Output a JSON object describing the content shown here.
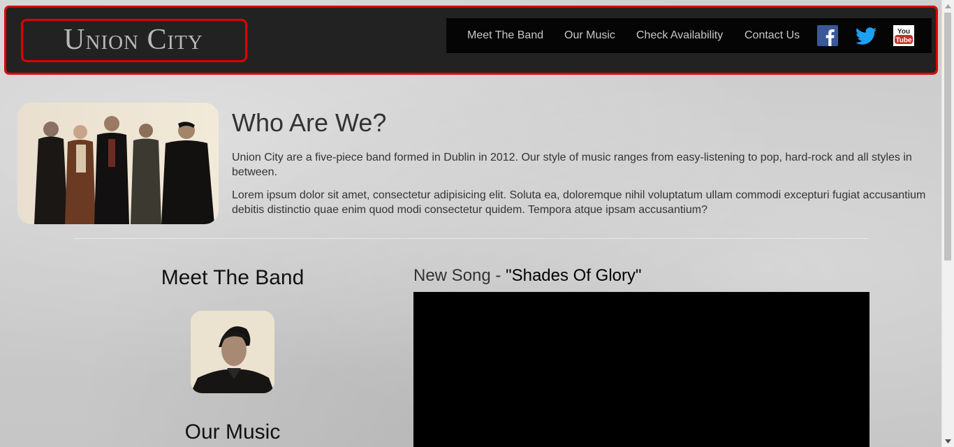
{
  "header": {
    "brand": "Union City",
    "nav": [
      {
        "label": "Meet The Band"
      },
      {
        "label": "Our Music"
      },
      {
        "label": "Check Availability"
      },
      {
        "label": "Contact Us"
      }
    ],
    "social": [
      "facebook-icon",
      "twitter-icon",
      "youtube-icon"
    ],
    "youtube_label_top": "You",
    "youtube_label_bottom": "Tube"
  },
  "about": {
    "title": "Who Are We?",
    "paragraph1": "Union City are a five-piece band formed in Dublin in 2012. Our style of music ranges from easy-listening to pop, hard-rock and all styles in between.",
    "paragraph2": "Lorem ipsum dolor sit amet, consectetur adipisicing elit. Soluta ea, doloremque nihil voluptatum ullam commodi excepturi fugiat accusantium debitis distinctio quae enim quod modi consectetur quidem. Tempora atque ipsam accusantium?"
  },
  "meet_band": {
    "title": "Meet The Band"
  },
  "our_music": {
    "title": "Our Music"
  },
  "new_song": {
    "prefix": "New Song",
    "separator": " - ",
    "name": "\"Shades Of Glory\""
  },
  "colors": {
    "navbar_bg": "#222222",
    "nav_panel_bg": "#050505",
    "highlight_outline": "#e00000",
    "facebook": "#3b5998",
    "twitter": "#1da1f2",
    "youtube": "#c4302b"
  }
}
